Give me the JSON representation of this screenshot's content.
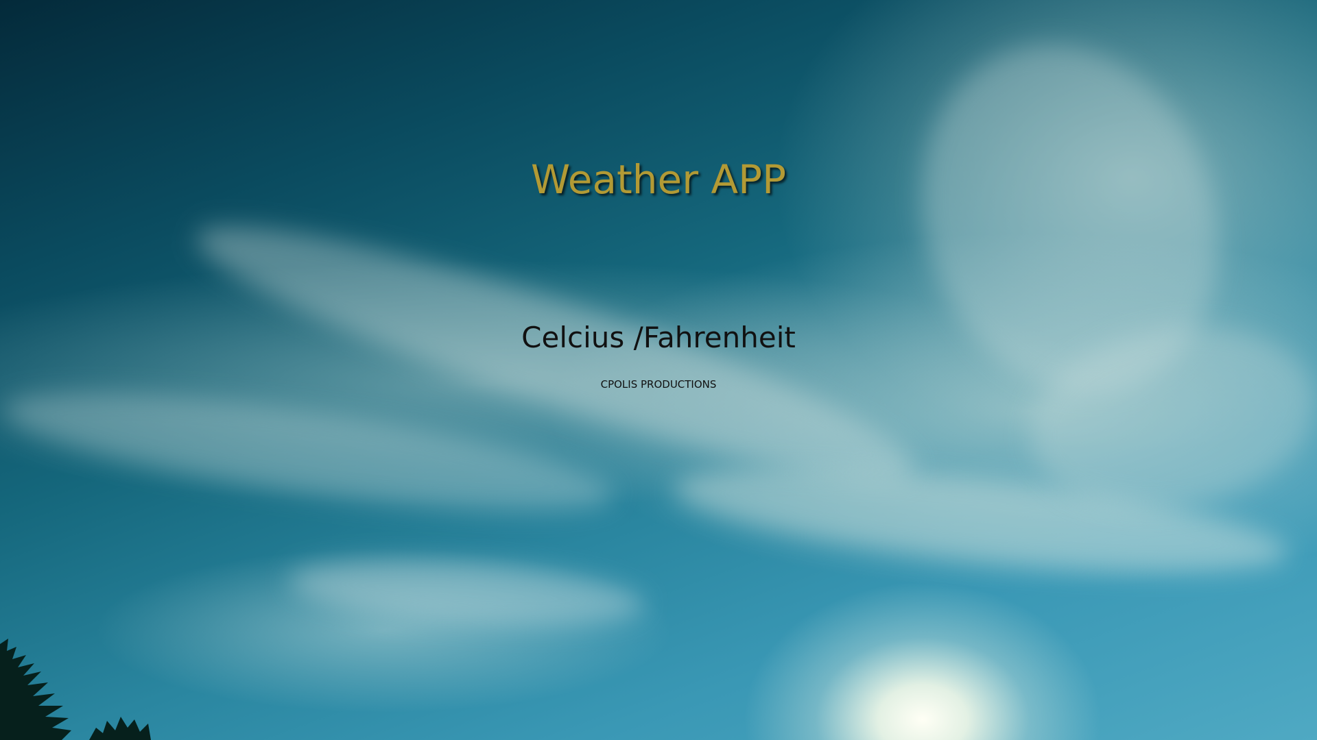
{
  "app": {
    "title": "Weather APP",
    "unit_toggle_label": "Celcius /Fahrenheit",
    "credit": "CPOLIS PRODUCTIONS"
  },
  "colors": {
    "title": "#b29a35",
    "text": "#111111",
    "sky_dark": "#042a3a",
    "sky_light": "#4fa9c3"
  },
  "background": {
    "icon": "sky-with-clouds-and-sun-image"
  }
}
